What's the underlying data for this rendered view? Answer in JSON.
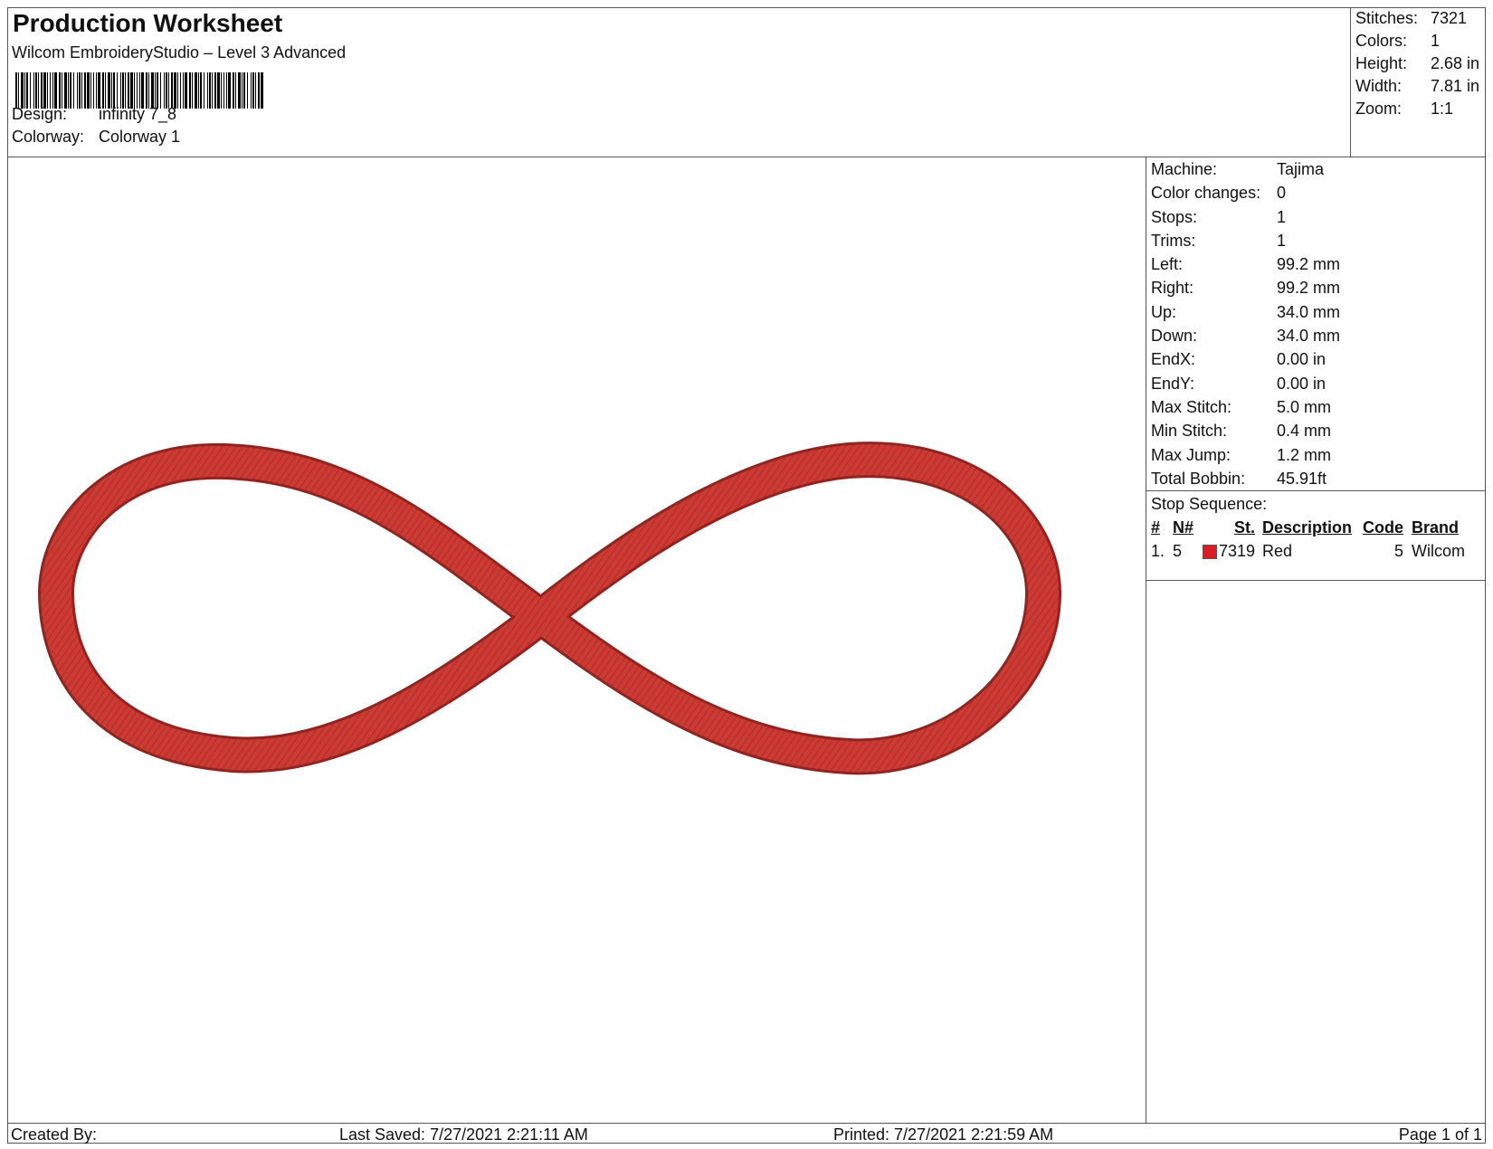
{
  "header": {
    "title": "Production Worksheet",
    "subtitle": "Wilcom EmbroideryStudio – Level 3 Advanced",
    "design_label": "Design:",
    "design_value": "infinity 7_8",
    "colorway_label": "Colorway:",
    "colorway_value": "Colorway 1"
  },
  "summary": {
    "stitches_label": "Stitches:",
    "stitches_value": "7321",
    "colors_label": "Colors:",
    "colors_value": "1",
    "height_label": "Height:",
    "height_value": "2.68 in",
    "width_label": "Width:",
    "width_value": "7.81 in",
    "zoom_label": "Zoom:",
    "zoom_value": "1:1"
  },
  "machine_info": [
    {
      "label": "Machine:",
      "value": "Tajima"
    },
    {
      "label": "Color changes:",
      "value": "0"
    },
    {
      "label": "Stops:",
      "value": "1"
    },
    {
      "label": "Trims:",
      "value": "1"
    },
    {
      "label": "Left:",
      "value": "99.2 mm"
    },
    {
      "label": "Right:",
      "value": "99.2 mm"
    },
    {
      "label": "Up:",
      "value": "34.0 mm"
    },
    {
      "label": "Down:",
      "value": "34.0 mm"
    },
    {
      "label": "EndX:",
      "value": "0.00 in"
    },
    {
      "label": "EndY:",
      "value": "0.00 in"
    },
    {
      "label": "Max Stitch:",
      "value": "5.0 mm"
    },
    {
      "label": "Min Stitch:",
      "value": "0.4 mm"
    },
    {
      "label": "Max Jump:",
      "value": "1.2 mm"
    },
    {
      "label": "Total Bobbin:",
      "value": "45.91ft"
    }
  ],
  "stop_sequence": {
    "heading": "Stop Sequence:",
    "columns": {
      "num": "#",
      "n": "N#",
      "st": "St.",
      "description": "Description",
      "code": "Code",
      "brand": "Brand"
    },
    "rows": [
      {
        "num": "1.",
        "n": "5",
        "color": "#d81e23",
        "st": "7319",
        "description": "Red",
        "code": "5",
        "brand": "Wilcom"
      }
    ]
  },
  "design_thread_color": "#cc3a33",
  "footer": {
    "created_by": "Created By:",
    "last_saved": "Last Saved: 7/27/2021 2:21:11 AM",
    "printed": "Printed: 7/27/2021 2:21:59 AM",
    "page": "Page 1 of 1"
  }
}
